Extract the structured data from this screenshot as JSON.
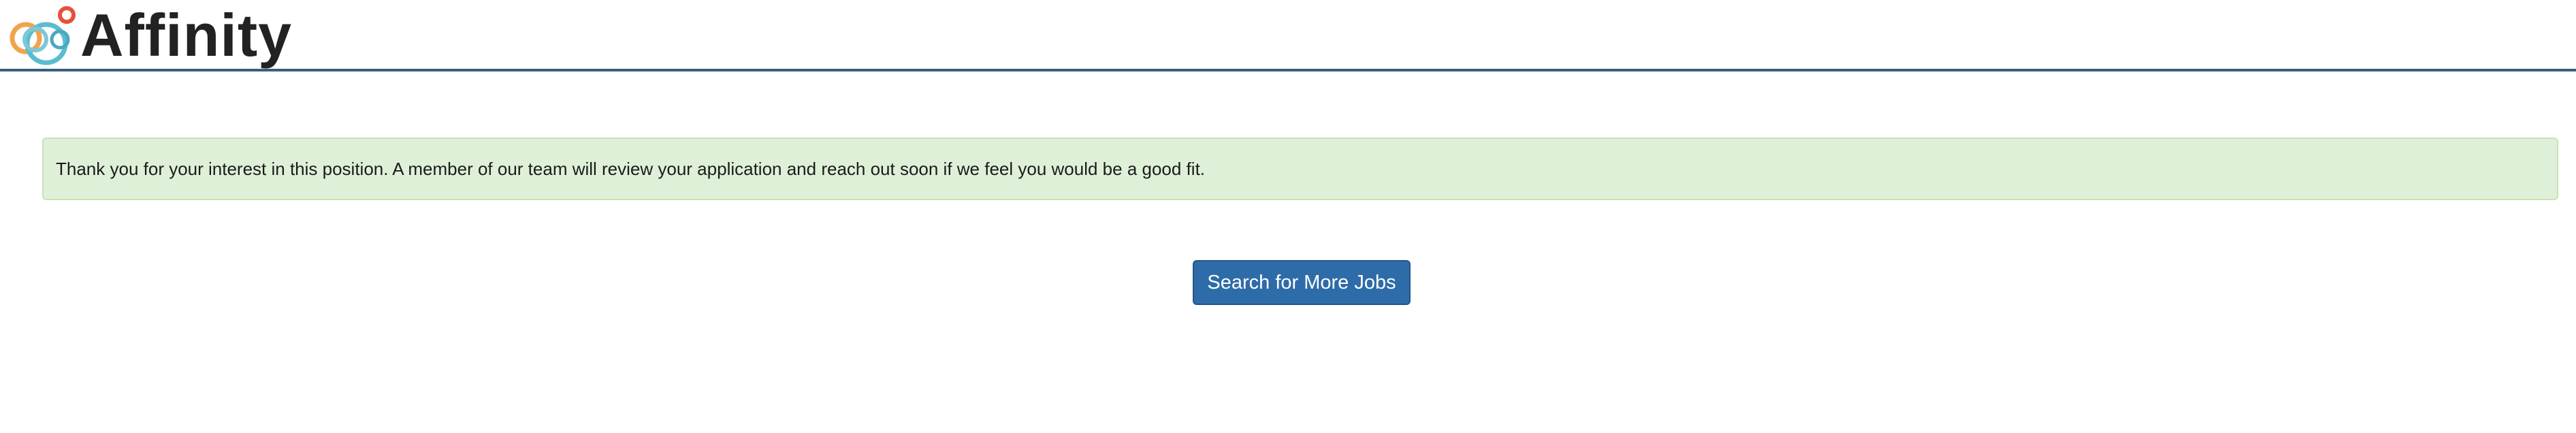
{
  "header": {
    "brand_name": "Affinity",
    "logo_icon": "affinity-rings-logo-icon",
    "rule_color": "#3a5f7d"
  },
  "main": {
    "confirmation_message": "Thank you for your interest in this position. A member of our team will review your application and reach out soon if we feel you would be a good fit.",
    "alert_background": "#dff0d8",
    "search_button_label": "Search for More Jobs",
    "button_color": "#2e6ca9"
  }
}
